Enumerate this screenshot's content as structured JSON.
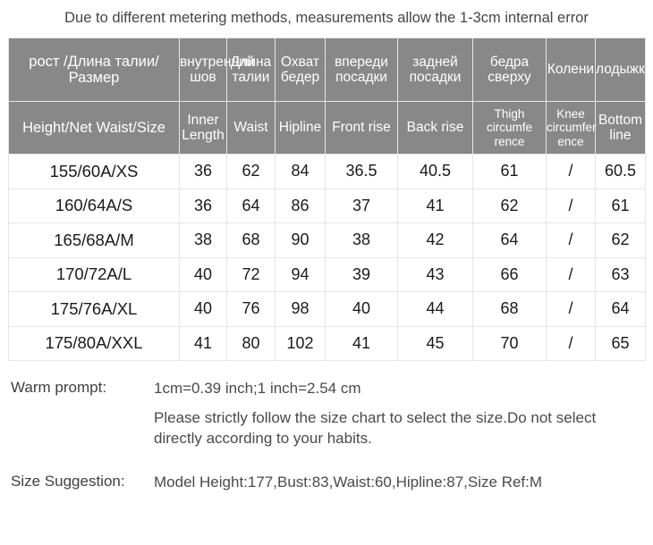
{
  "top_notice": "Due to different metering methods, measurements allow the 1-3cm internal error",
  "table": {
    "headers_ru": [
      "рост /Длина талии/Размер",
      "внутренний шов",
      "Длина талии",
      "Охват бедер",
      "впереди посадки",
      "задней посадки",
      "бедра сверху",
      "Колени",
      "лодыжки"
    ],
    "headers_en": [
      "Height/Net Waist/Size",
      "Inner Length",
      "Waist",
      "Hipline",
      "Front rise",
      "Back rise",
      "Thigh circumfe rence",
      "Knee circumfer ence",
      "Bottom line"
    ],
    "rows": [
      {
        "size": "155/60A/XS",
        "inner_length": "36",
        "waist": "62",
        "hipline": "84",
        "front_rise": "36.5",
        "back_rise": "40.5",
        "thigh": "61",
        "knee": "/",
        "bottom": "60.5"
      },
      {
        "size": "160/64A/S",
        "inner_length": "36",
        "waist": "64",
        "hipline": "86",
        "front_rise": "37",
        "back_rise": "41",
        "thigh": "62",
        "knee": "/",
        "bottom": "61"
      },
      {
        "size": "165/68A/M",
        "inner_length": "38",
        "waist": "68",
        "hipline": "90",
        "front_rise": "38",
        "back_rise": "42",
        "thigh": "64",
        "knee": "/",
        "bottom": "62"
      },
      {
        "size": "170/72A/L",
        "inner_length": "40",
        "waist": "72",
        "hipline": "94",
        "front_rise": "39",
        "back_rise": "43",
        "thigh": "66",
        "knee": "/",
        "bottom": "63"
      },
      {
        "size": "175/76A/XL",
        "inner_length": "40",
        "waist": "76",
        "hipline": "98",
        "front_rise": "40",
        "back_rise": "44",
        "thigh": "68",
        "knee": "/",
        "bottom": "64"
      },
      {
        "size": "175/80A/XXL",
        "inner_length": "41",
        "waist": "80",
        "hipline": "102",
        "front_rise": "41",
        "back_rise": "45",
        "thigh": "70",
        "knee": "/",
        "bottom": "65"
      }
    ]
  },
  "notes": {
    "warm_prompt_label": "Warm prompt:",
    "conversion": "1cm=0.39 inch;1 inch=2.54 cm",
    "instruction": "Please strictly follow the size chart  to select the size.Do not select directly according to your habits.",
    "size_suggestion_label": "Size Suggestion:",
    "size_suggestion_value": "Model Height:177,Bust:83,Waist:60,Hipline:87,Size Ref:M"
  },
  "colors": {
    "header_bg": "#888888",
    "header_text": "#ffffff",
    "cell_text": "#1a1a1a",
    "grid_line": "#ececec",
    "note_text": "#4a4a4a"
  }
}
